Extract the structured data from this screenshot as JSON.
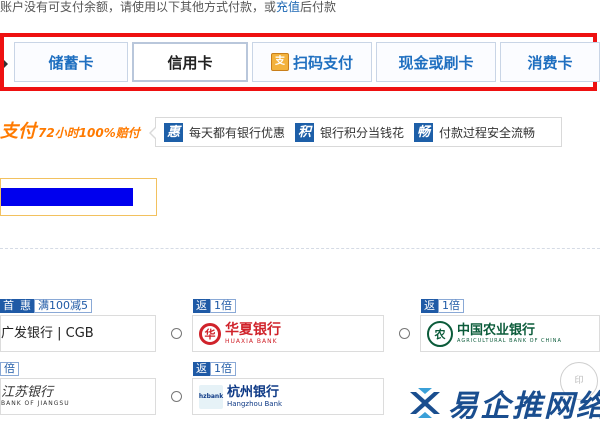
{
  "notice": {
    "prefix": "账户没有可支付余额，请使用以下其他方式付款，或",
    "link": "充值",
    "suffix": "后付款"
  },
  "tabs": [
    {
      "label": "储蓄卡"
    },
    {
      "label": "信用卡"
    },
    {
      "label": "扫码支付",
      "badge": "支"
    },
    {
      "label": "现金或刷卡"
    },
    {
      "label": "消费卡"
    }
  ],
  "promo": {
    "left_big": "支付",
    "left_small": "72小时100%赔付",
    "features": [
      {
        "icon": "惠",
        "text": "每天都有银行优惠"
      },
      {
        "icon": "积",
        "text": "银行积分当钱花"
      },
      {
        "icon": "畅",
        "text": "付款过程安全流畅"
      }
    ]
  },
  "banks": [
    {
      "tags": [
        "首",
        "惠",
        "满100减5"
      ],
      "name": "广发银行 | CGB",
      "sub": ""
    },
    {
      "tags": [
        "返",
        "1倍"
      ],
      "name": "华夏银行",
      "sub": "HUAXIA BANK",
      "mark": "华"
    },
    {
      "tags": [
        "返",
        "1倍"
      ],
      "name": "中国农业银行",
      "sub": "AGRICULTURAL BANK OF CHINA",
      "mark": "农"
    },
    {
      "tags": [
        "倍"
      ],
      "name": "江苏银行",
      "sub": "BANK OF JIANGSU"
    },
    {
      "tags": [
        "返",
        "1倍"
      ],
      "name": "杭州银行",
      "sub": "Hangzhou Bank",
      "mark": "hzbank"
    }
  ],
  "watermark": {
    "text": "易企推网络",
    "seal": "印"
  },
  "colors": {
    "accent": "#1f6fc0",
    "highlight": "#ee1111",
    "promo": "#ff7a00",
    "masked": "#0000ee"
  }
}
